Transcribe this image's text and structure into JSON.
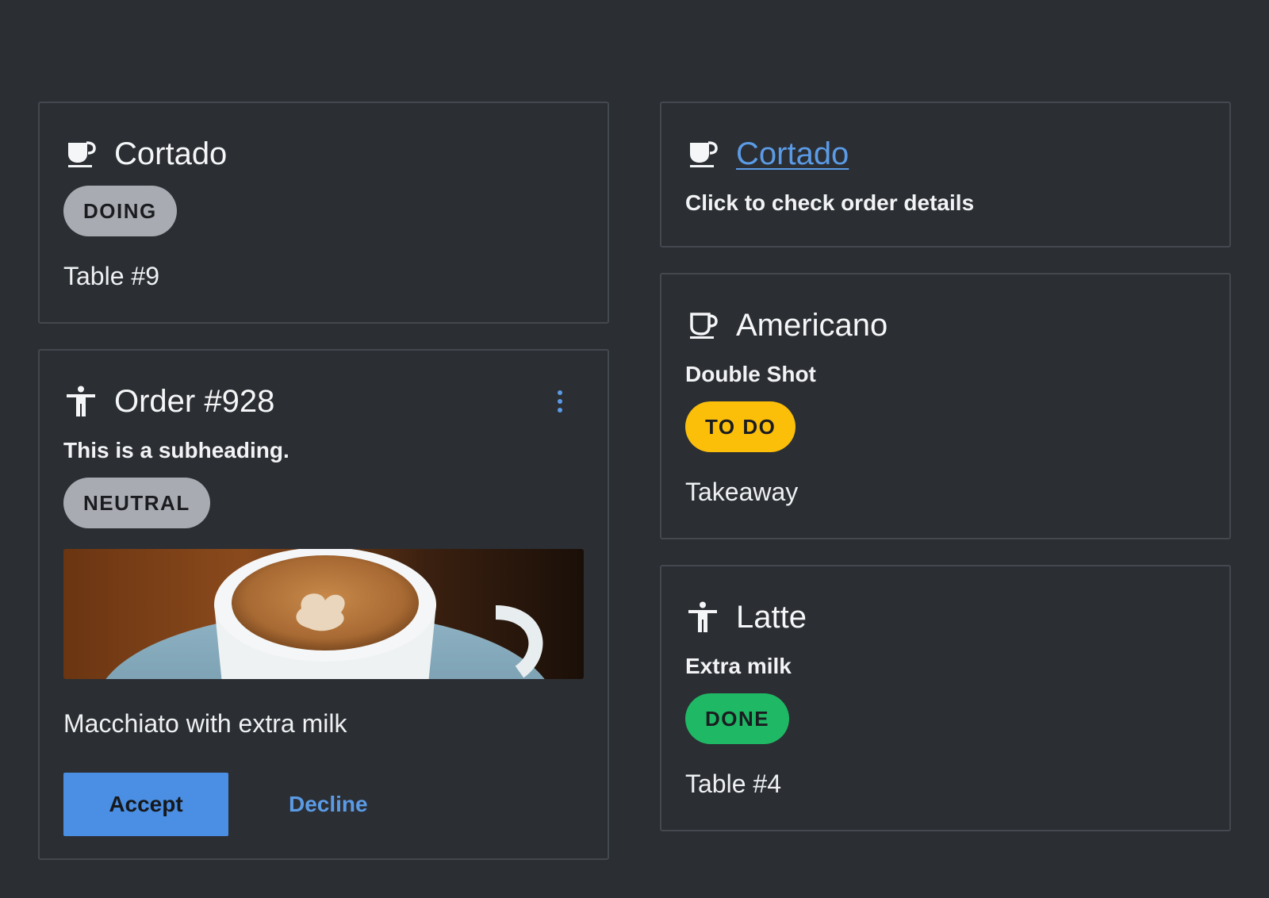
{
  "cards": {
    "cortado_doing": {
      "icon": "coffee-cup-icon",
      "title": "Cortado",
      "status": "DOING",
      "status_color": "#a8abb1",
      "note": "Table #9"
    },
    "order_928": {
      "icon": "accessibility-person-icon",
      "title": "Order #928",
      "subheading": "This is a subheading.",
      "status": "NEUTRAL",
      "status_color": "#a8abb1",
      "image_icon": "coffee-latte-art-photo",
      "description": "Macchiato with extra milk",
      "accept_label": "Accept",
      "decline_label": "Decline",
      "menu_icon": "kebab-menu-icon"
    },
    "cortado_link": {
      "icon": "coffee-cup-icon",
      "title": "Cortado",
      "subheading": "Click to check order details"
    },
    "americano": {
      "icon": "coffee-mug-icon",
      "title": "Americano",
      "subheading": "Double Shot",
      "status": "TO DO",
      "status_color": "#fbbf0a",
      "note": "Takeaway"
    },
    "latte": {
      "icon": "accessibility-person-icon",
      "title": "Latte",
      "subheading": "Extra milk",
      "status": "DONE",
      "status_color": "#1fb865",
      "note": "Table #4"
    }
  },
  "colors": {
    "background": "#2b2e33",
    "border": "#44484f",
    "accent": "#4a8fe3",
    "link": "#5b9be6"
  }
}
